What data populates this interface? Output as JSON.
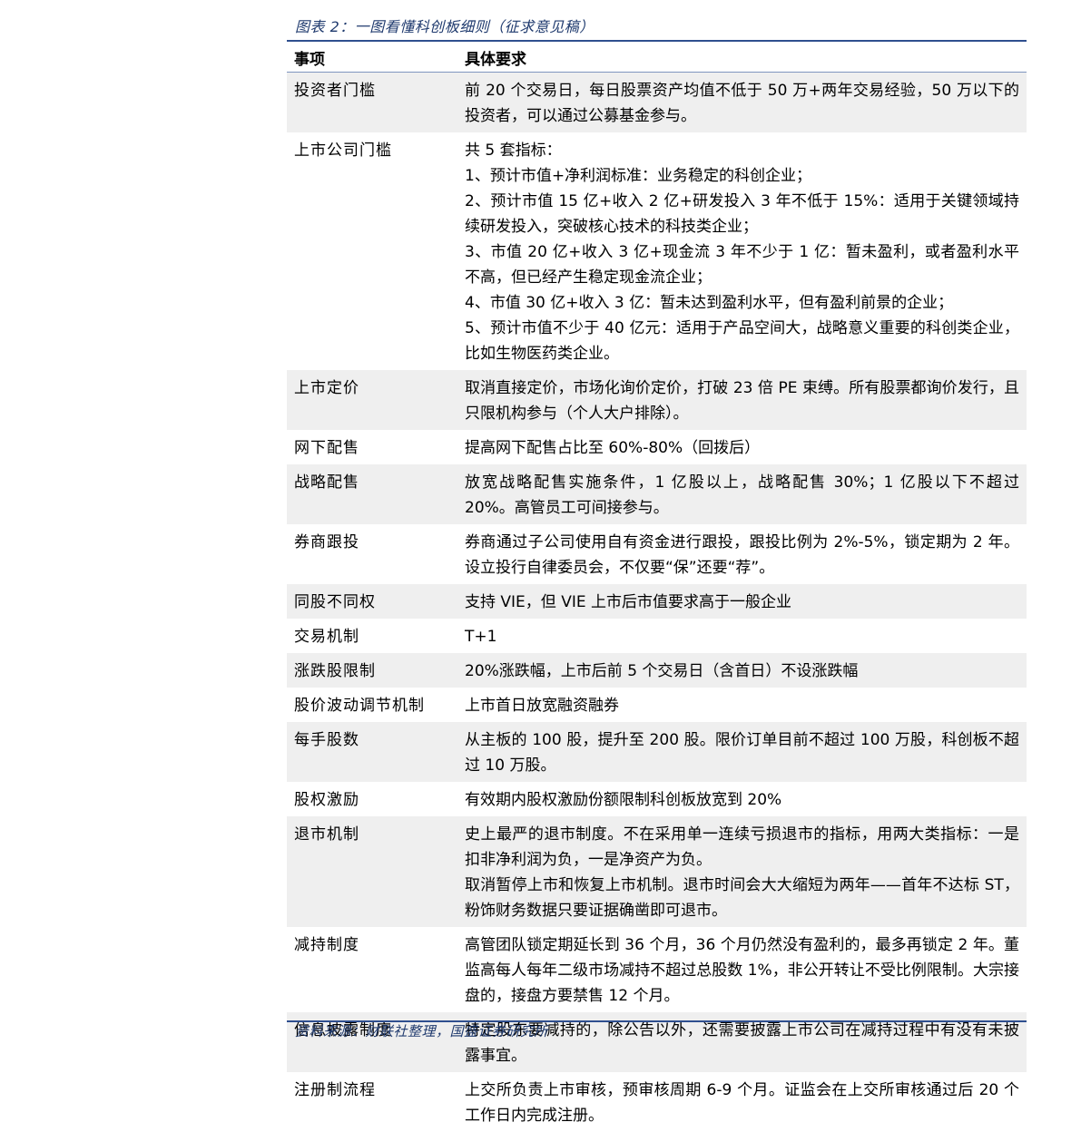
{
  "caption": "图表 2：一图看懂科创板细则（征求意见稿）",
  "header": {
    "col1": "事项",
    "col2": "具体要求"
  },
  "rows": [
    {
      "item": "投资者门槛",
      "lines": [
        "前 20 个交易日，每日股票资产均值不低于 50 万+两年交易经验，50 万以下的投资者，可以通过公募基金参与。"
      ]
    },
    {
      "item": "上市公司门槛",
      "lines": [
        "共 5 套指标：",
        "1、预计市值+净利润标准：业务稳定的科创企业；",
        "2、预计市值 15 亿+收入 2 亿+研发投入 3 年不低于 15%：适用于关键领域持续研发投入，突破核心技术的科技类企业；",
        "3、市值 20 亿+收入 3 亿+现金流 3 年不少于 1 亿：暂未盈利，或者盈利水平不高，但已经产生稳定现金流企业；",
        "4、市值 30 亿+收入 3 亿：暂未达到盈利水平，但有盈利前景的企业；",
        "5、预计市值不少于 40 亿元：适用于产品空间大，战略意义重要的科创类企业，比如生物医药类企业。"
      ]
    },
    {
      "item": "上市定价",
      "lines": [
        "取消直接定价，市场化询价定价，打破 23 倍 PE 束缚。所有股票都询价发行，且只限机构参与（个人大户排除）。"
      ]
    },
    {
      "item": "网下配售",
      "lines": [
        "提高网下配售占比至 60%-80%（回拨后）"
      ]
    },
    {
      "item": "战略配售",
      "lines": [
        "放宽战略配售实施条件，1 亿股以上，战略配售 30%；1 亿股以下不超过 20%。高管员工可间接参与。"
      ]
    },
    {
      "item": "券商跟投",
      "lines": [
        "券商通过子公司使用自有资金进行跟投，跟投比例为 2%-5%，锁定期为 2 年。设立投行自律委员会，不仅要“保”还要“荐”。"
      ]
    },
    {
      "item": "同股不同权",
      "lines": [
        "支持 VIE，但 VIE 上市后市值要求高于一般企业"
      ]
    },
    {
      "item": "交易机制",
      "lines": [
        "T+1"
      ]
    },
    {
      "item": "涨跌股限制",
      "lines": [
        "20%涨跌幅，上市后前 5 个交易日（含首日）不设涨跌幅"
      ]
    },
    {
      "item": "股价波动调节机制",
      "lines": [
        "上市首日放宽融资融券"
      ]
    },
    {
      "item": "每手股数",
      "lines": [
        "从主板的 100 股，提升至 200 股。限价订单目前不超过 100 万股，科创板不超过 10 万股。"
      ]
    },
    {
      "item": "股权激励",
      "lines": [
        "有效期内股权激励份额限制科创板放宽到 20%"
      ]
    },
    {
      "item": "退市机制",
      "lines": [
        "史上最严的退市制度。不在采用单一连续亏损退市的指标，用两大类指标：一是扣非净利润为负，一是净资产为负。",
        "取消暂停上市和恢复上市机制。退市时间会大大缩短为两年——首年不达标 ST，粉饰财务数据只要证据确凿即可退市。"
      ]
    },
    {
      "item": "减持制度",
      "lines": [
        "高管团队锁定期延长到 36 个月，36 个月仍然没有盈利的，最多再锁定 2 年。董监高每人每年二级市场减持不超过总股数 1%，非公开转让不受比例限制。大宗接盘的，接盘方要禁售 12 个月。"
      ]
    },
    {
      "item": "信息披露制度",
      "lines": [
        "特定股东要减持的，除公告以外，还需要披露上市公司在减持过程中有没有未披露事宜。"
      ]
    },
    {
      "item": "注册制流程",
      "lines": [
        "上交所负责上市审核，预审核周期 6-9 个月。证监会在上交所审核通过后 20 个工作日内完成注册。"
      ]
    }
  ],
  "source": "资料来源：财联社整理，国盛证券研究所"
}
